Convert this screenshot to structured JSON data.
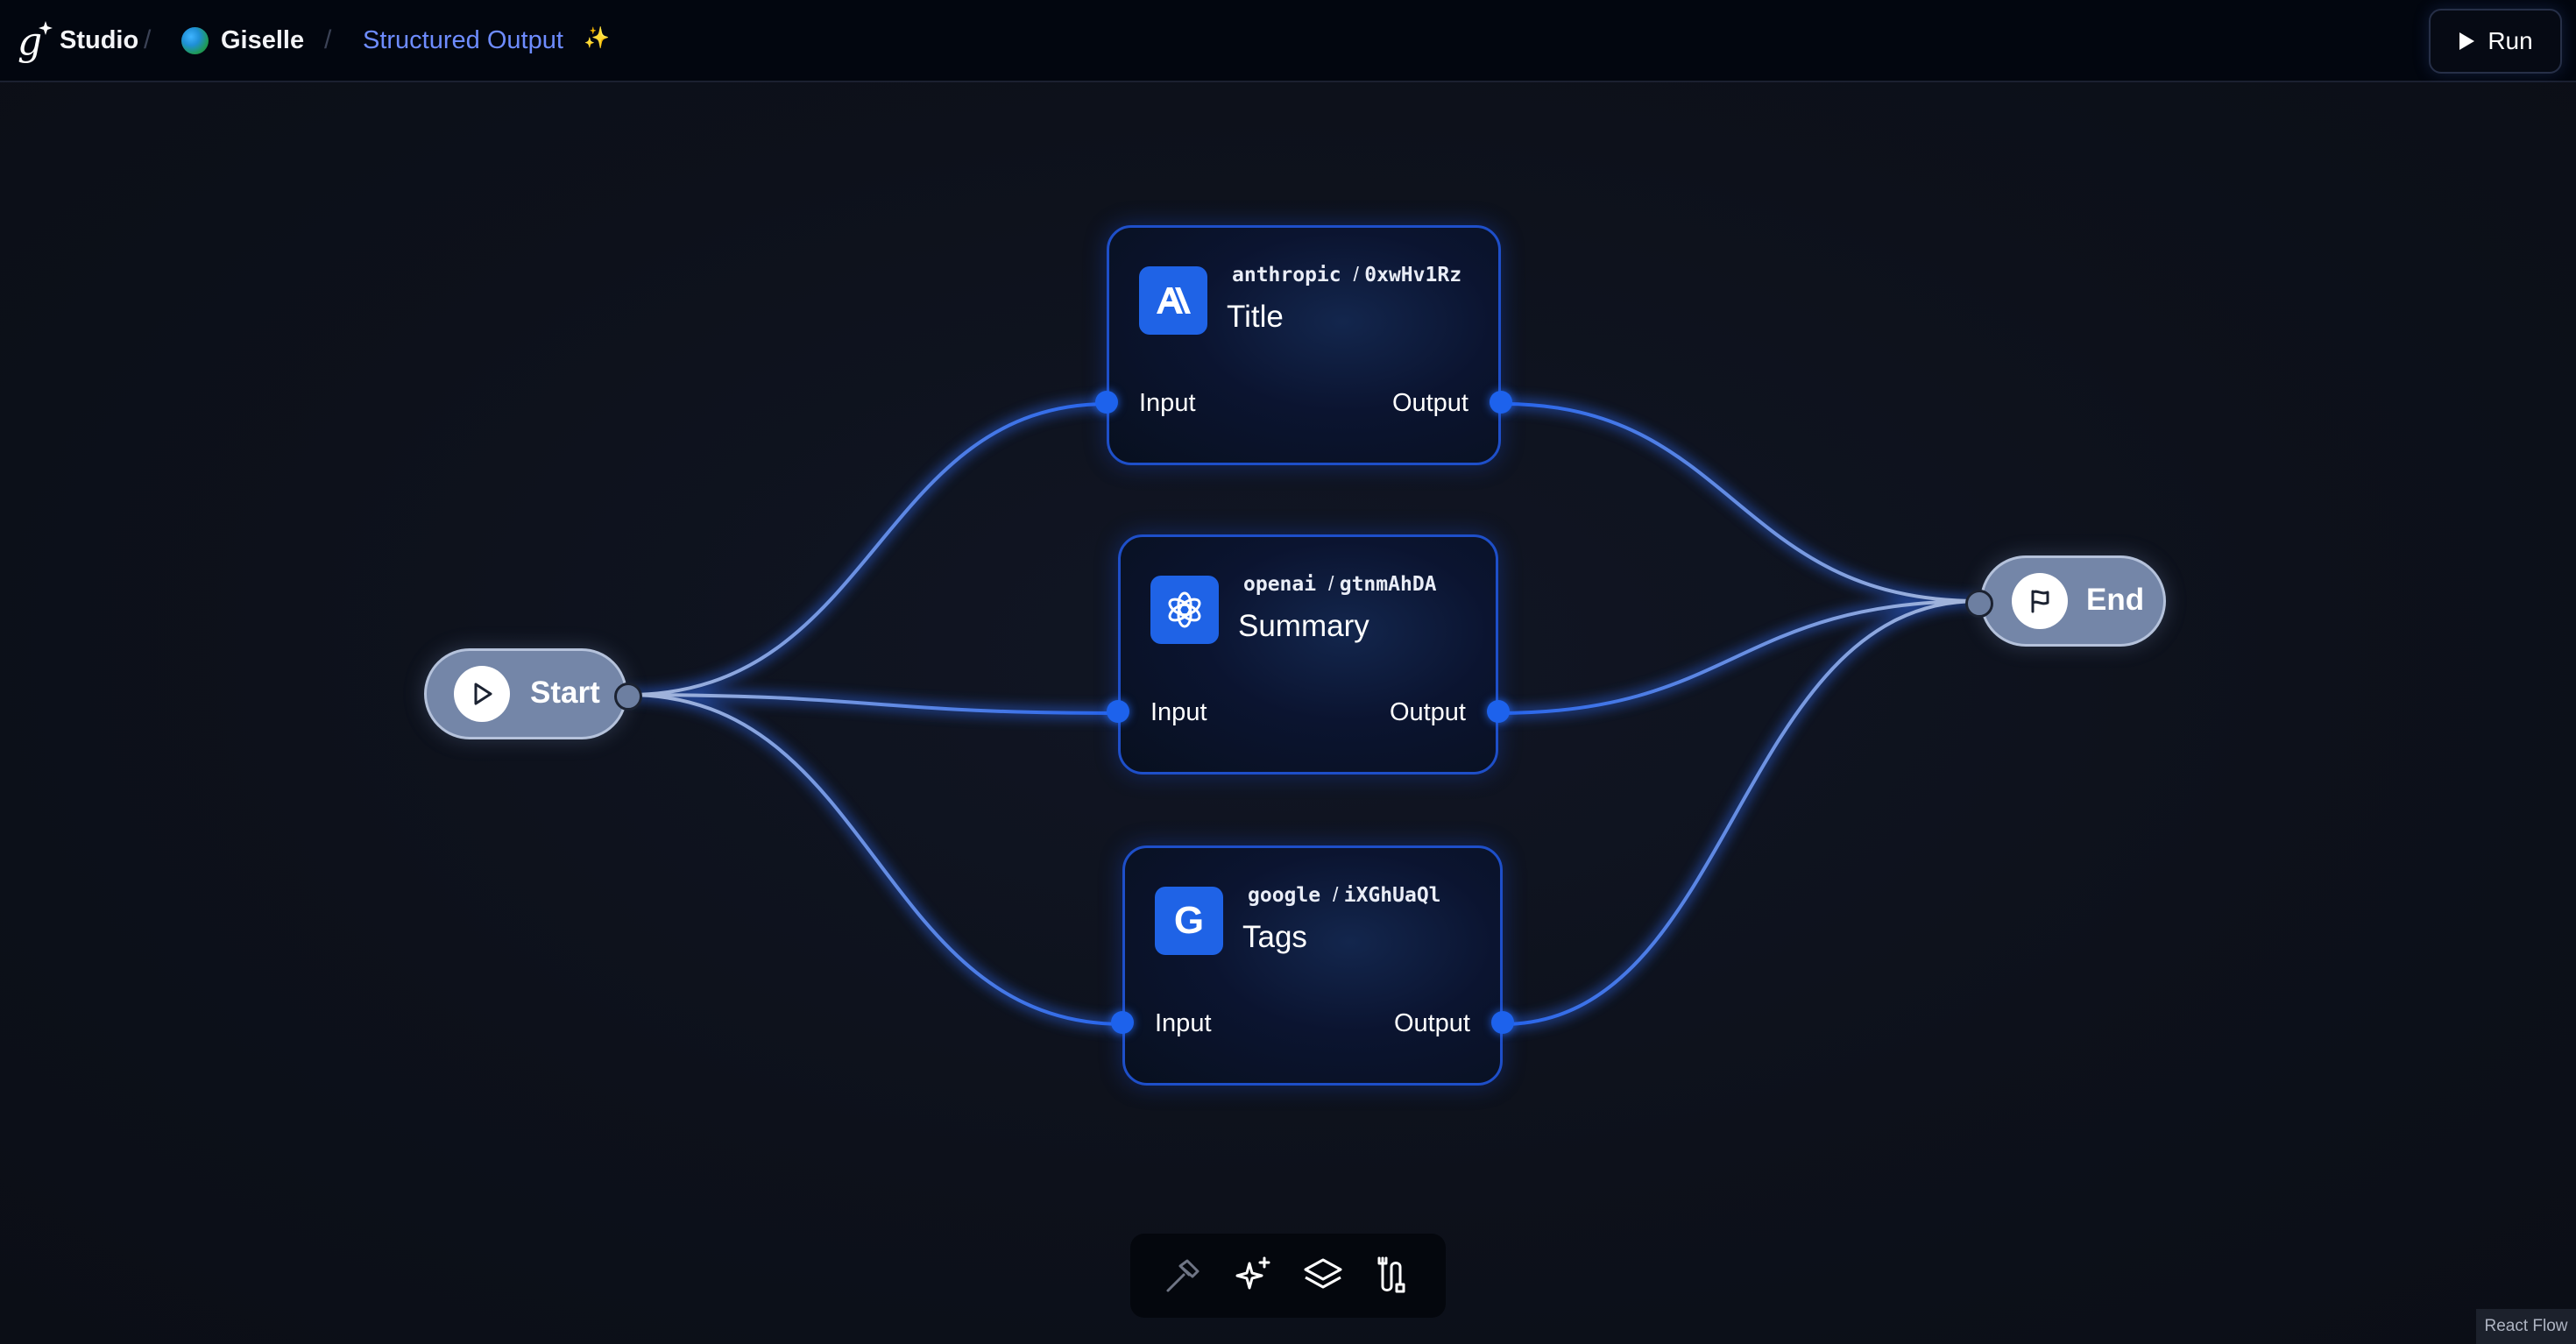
{
  "header": {
    "studio_label": "Studio",
    "team_label": "Giselle",
    "project_label": "Structured Output",
    "project_emoji": "✨",
    "separator": "/",
    "run_label": "Run"
  },
  "flow": {
    "start_label": "Start",
    "end_label": "End",
    "nodes": [
      {
        "provider": "anthropic",
        "node_id": "0xwHv1Rz",
        "title": "Title",
        "icon": "anthropic-icon",
        "input_label": "Input",
        "output_label": "Output"
      },
      {
        "provider": "openai",
        "node_id": "gtnmAhDA",
        "title": "Summary",
        "icon": "openai-icon",
        "input_label": "Input",
        "output_label": "Output"
      },
      {
        "provider": "google",
        "node_id": "iXGhUaQl",
        "title": "Tags",
        "icon": "google-icon",
        "input_label": "Input",
        "output_label": "Output"
      }
    ]
  },
  "toolbar": {
    "tools": [
      "hammer-icon",
      "sparkles-icon",
      "layers-icon",
      "route-icon"
    ]
  },
  "attribution": "React Flow",
  "colors": {
    "accent": "#1f63e6",
    "edge": "#3d74f0",
    "project_link": "#6e8cff",
    "pill": "#7486a8"
  }
}
